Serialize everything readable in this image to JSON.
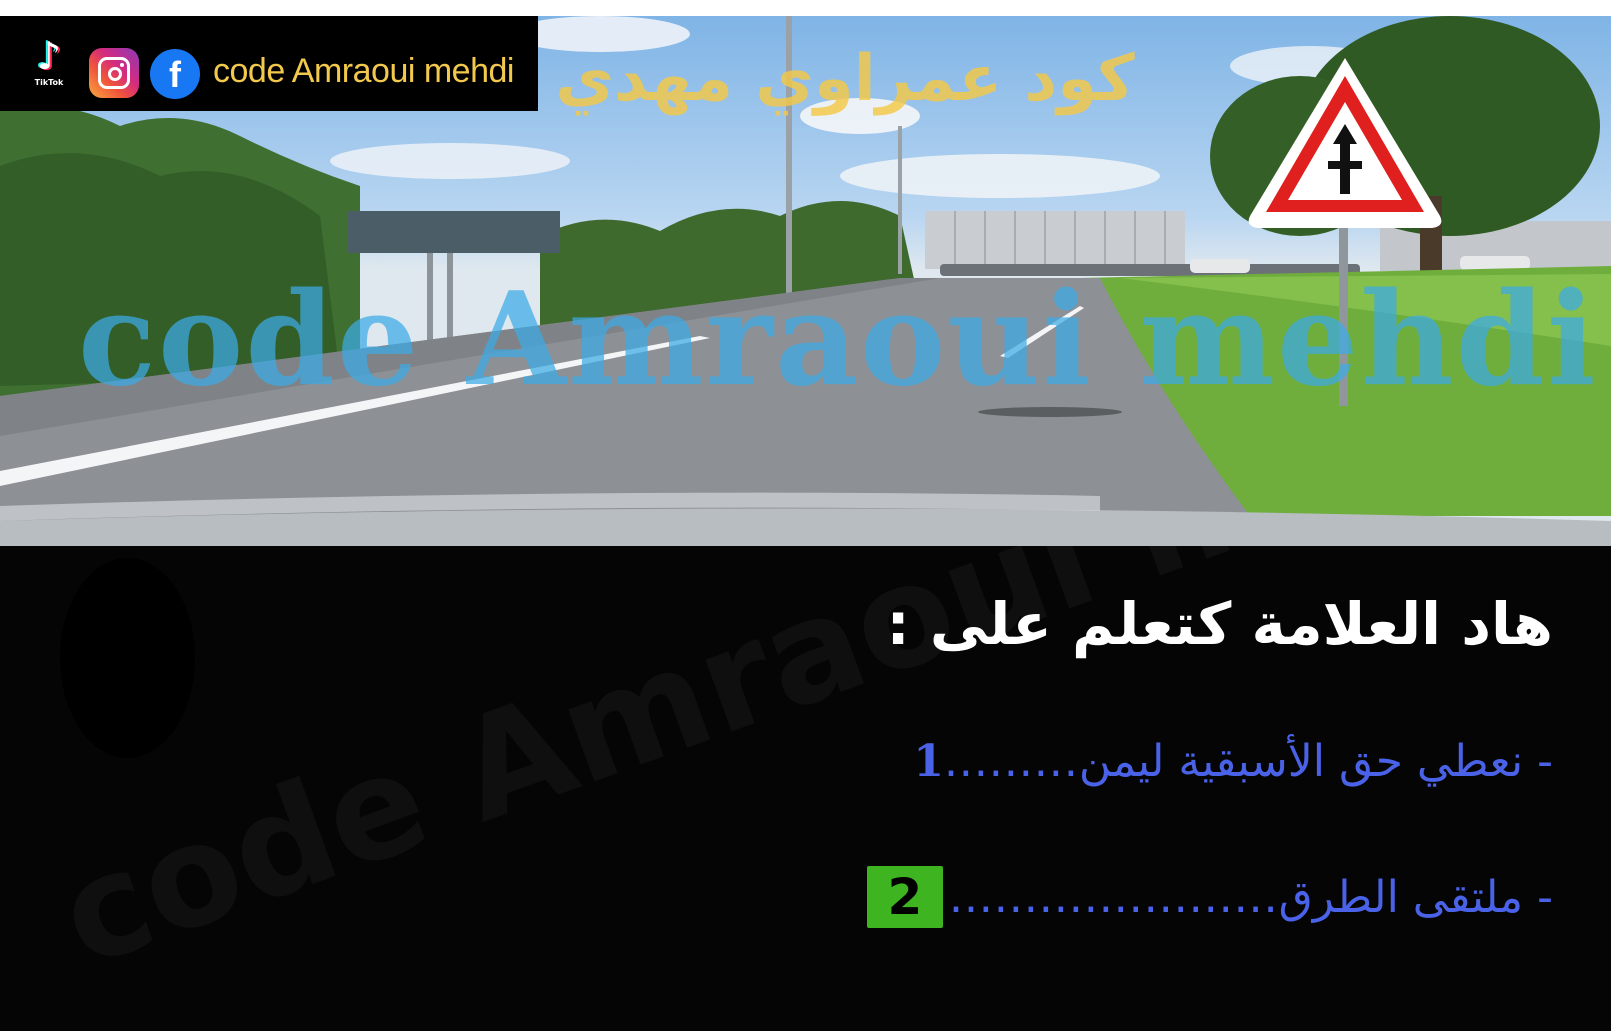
{
  "branding": {
    "tiktok_glyph": "♪",
    "tiktok_label": "TikTok",
    "facebook_letter": "f",
    "name": "code Amraoui mehdi"
  },
  "watermarks": {
    "arabic": "كود عمراوي مهدي",
    "latin": "code Amraoui mehdi",
    "panel": "code Amraoui mehdi"
  },
  "question": {
    "text": "هاد العلامة كتعلم على :",
    "answers": [
      {
        "text": "- نعطي حق الأسبقية ليمن",
        "dots": ".........",
        "number": "1"
      },
      {
        "text": "- ملتقى الطرق",
        "dots": "......................",
        "number": "2"
      }
    ]
  },
  "colors": {
    "answer_text": "#4a62e8",
    "number_box": "#3fb421",
    "brand_text": "#f2c94c",
    "watermark_latin": "#3caae6"
  },
  "sign": {
    "type": "warning-triangle",
    "meaning": "intersection with priority over minor road"
  }
}
